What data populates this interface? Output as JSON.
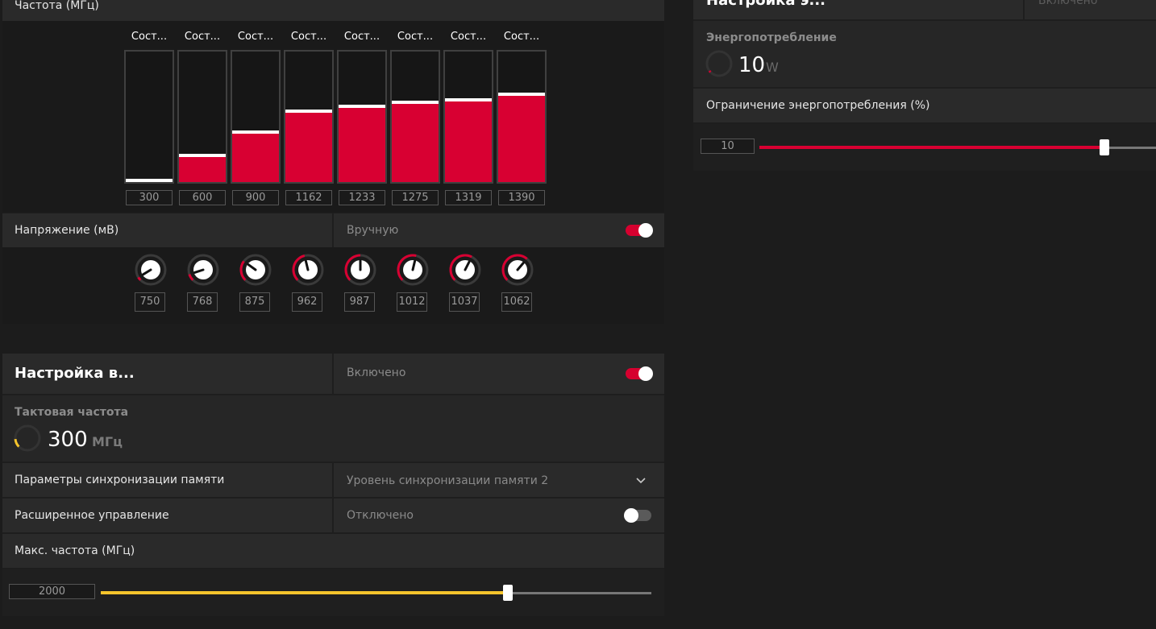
{
  "freq_section": {
    "title": "Частота (МГц)",
    "states": [
      {
        "label": "Сост...",
        "value": "300",
        "level": 0.0
      },
      {
        "label": "Сост...",
        "value": "600",
        "level": 0.19
      },
      {
        "label": "Сост...",
        "value": "900",
        "level": 0.37
      },
      {
        "label": "Сост...",
        "value": "1162",
        "level": 0.53
      },
      {
        "label": "Сост...",
        "value": "1233",
        "level": 0.57
      },
      {
        "label": "Сост...",
        "value": "1275",
        "level": 0.6
      },
      {
        "label": "Сост...",
        "value": "1319",
        "level": 0.62
      },
      {
        "label": "Сост...",
        "value": "1390",
        "level": 0.66
      }
    ]
  },
  "voltage_section": {
    "label": "Напряжение (мВ)",
    "mode": "Вручную",
    "toggle_on": true,
    "knobs": [
      {
        "value": "750",
        "level": 0.05
      },
      {
        "value": "768",
        "level": 0.1
      },
      {
        "value": "875",
        "level": 0.3
      },
      {
        "value": "962",
        "level": 0.45
      },
      {
        "value": "987",
        "level": 0.5
      },
      {
        "value": "1012",
        "level": 0.55
      },
      {
        "value": "1037",
        "level": 0.6
      },
      {
        "value": "1062",
        "level": 0.65
      }
    ]
  },
  "vram_section": {
    "title": "Настройка в...",
    "status": "Включено",
    "toggle_on": true,
    "clock_label": "Тактовая частота",
    "clock_value": "300",
    "clock_unit": "МГц",
    "clock_level": 0.15,
    "timing_label": "Параметры синхронизации памяти",
    "timing_value": "Уровень синхронизации памяти 2",
    "advanced_label": "Расширенное управление",
    "advanced_status": "Отключено",
    "advanced_on": false,
    "maxfreq_label": "Макс. частота (МГц)",
    "maxfreq_value": "2000",
    "maxfreq_level": 0.74
  },
  "power_section": {
    "title": "Настройка э...",
    "status": "Включено",
    "usage_label": "Энергопотребление",
    "usage_value": "10",
    "usage_unit": "W",
    "usage_level": 0.03,
    "limit_label": "Ограничение энергопотребления (%)",
    "limit_value": "10",
    "limit_level": 0.87
  },
  "colors": {
    "accent_red": "#d80032",
    "accent_yellow": "#f5c42c"
  },
  "icons": {
    "dropdown": "chevron-down-icon"
  }
}
